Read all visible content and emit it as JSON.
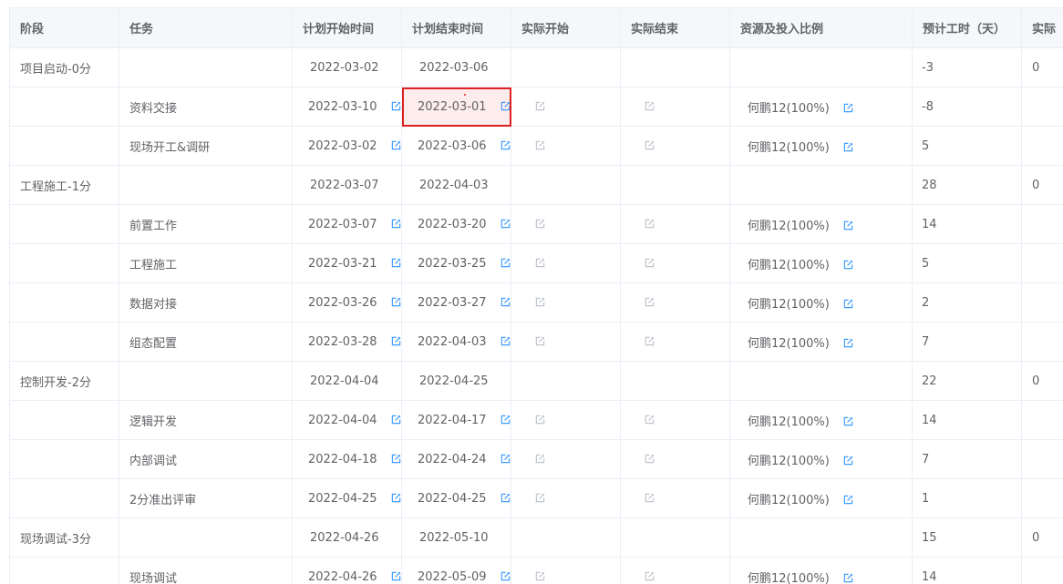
{
  "columns": [
    "阶段",
    "任务",
    "计划开始时间",
    "计划结束时间",
    "实际开始",
    "实际结束",
    "资源及投入比例",
    "预计工时（天）",
    "实际"
  ],
  "rows": [
    {
      "type": "stage",
      "stage": "项目启动-0分",
      "start": "2022-03-02",
      "end": "2022-03-06",
      "hours": "-3",
      "actual": "0"
    },
    {
      "type": "task",
      "task": "资料交接",
      "start": "2022-03-10",
      "end": "2022-03-01",
      "resource": "何鹏12(100%)",
      "hours": "-8",
      "highlight_end": true
    },
    {
      "type": "task",
      "task": "现场开工&调研",
      "start": "2022-03-02",
      "end": "2022-03-06",
      "resource": "何鹏12(100%)",
      "hours": "5"
    },
    {
      "type": "stage",
      "stage": "工程施工-1分",
      "start": "2022-03-07",
      "end": "2022-04-03",
      "hours": "28",
      "actual": "0"
    },
    {
      "type": "task",
      "task": "前置工作",
      "start": "2022-03-07",
      "end": "2022-03-20",
      "resource": "何鹏12(100%)",
      "hours": "14"
    },
    {
      "type": "task",
      "task": "工程施工",
      "start": "2022-03-21",
      "end": "2022-03-25",
      "resource": "何鹏12(100%)",
      "hours": "5"
    },
    {
      "type": "task",
      "task": "数据对接",
      "start": "2022-03-26",
      "end": "2022-03-27",
      "resource": "何鹏12(100%)",
      "hours": "2"
    },
    {
      "type": "task",
      "task": "组态配置",
      "start": "2022-03-28",
      "end": "2022-04-03",
      "resource": "何鹏12(100%)",
      "hours": "7"
    },
    {
      "type": "stage",
      "stage": "控制开发-2分",
      "start": "2022-04-04",
      "end": "2022-04-25",
      "hours": "22",
      "actual": "0"
    },
    {
      "type": "task",
      "task": "逻辑开发",
      "start": "2022-04-04",
      "end": "2022-04-17",
      "resource": "何鹏12(100%)",
      "hours": "14"
    },
    {
      "type": "task",
      "task": "内部调试",
      "start": "2022-04-18",
      "end": "2022-04-24",
      "resource": "何鹏12(100%)",
      "hours": "7"
    },
    {
      "type": "task",
      "task": "2分准出评审",
      "start": "2022-04-25",
      "end": "2022-04-25",
      "resource": "何鹏12(100%)",
      "hours": "1"
    },
    {
      "type": "stage",
      "stage": "现场调试-3分",
      "start": "2022-04-26",
      "end": "2022-05-10",
      "hours": "15",
      "actual": "0"
    },
    {
      "type": "task",
      "task": "现场调试",
      "start": "2022-04-26",
      "end": "2022-05-09",
      "resource": "何鹏12(100%)",
      "hours": "14"
    }
  ],
  "colors": {
    "header_bg": "#f5f7fa",
    "border": "#ebeef5",
    "edit_active": "#409eff",
    "edit_disabled": "#c0c4cc",
    "error": "#e02020"
  }
}
